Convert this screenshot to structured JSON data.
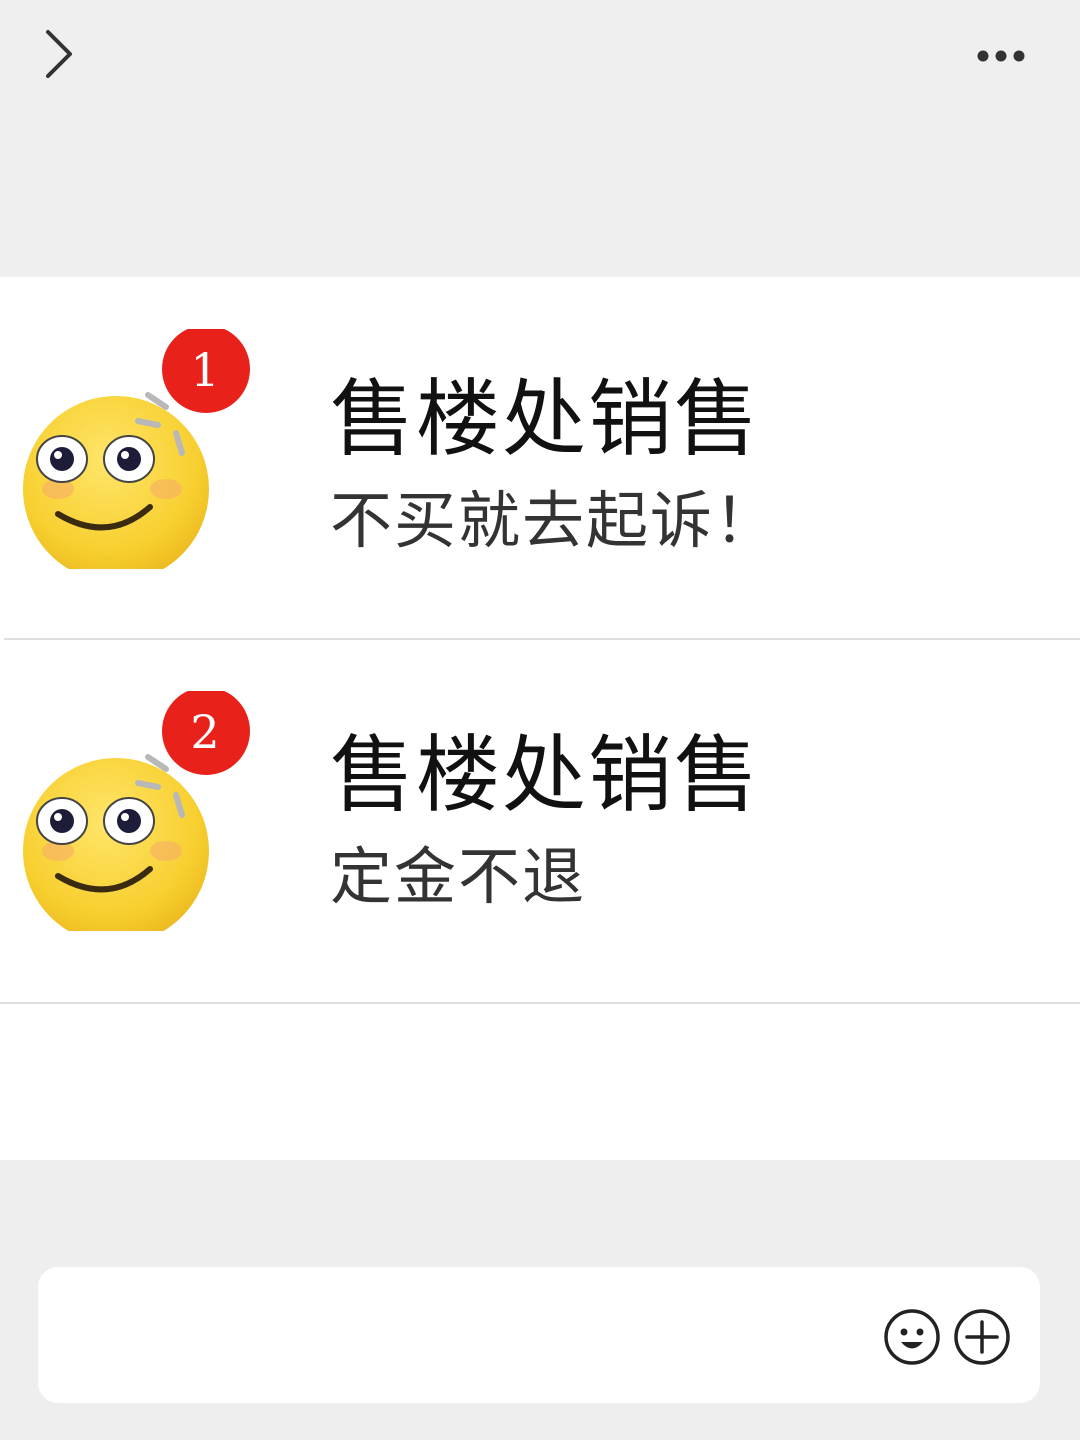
{
  "header": {
    "back_icon": "chevron-right-icon",
    "more_icon": "more-dots-icon"
  },
  "messages": [
    {
      "badge": "1",
      "title": "售楼处销售",
      "subtitle": "不买就去起诉！",
      "avatar_icon": "smiling-emoji-face"
    },
    {
      "badge": "2",
      "title": "售楼处销售",
      "subtitle": "定金不退",
      "avatar_icon": "smiling-emoji-face"
    }
  ],
  "composer": {
    "input_value": "",
    "emoji_icon": "emoji-icon",
    "plus_icon": "plus-circle-icon"
  },
  "colors": {
    "badge_red": "#e8211a",
    "emoji_yellow": "#f8d33a",
    "background": "#eeeeee"
  }
}
